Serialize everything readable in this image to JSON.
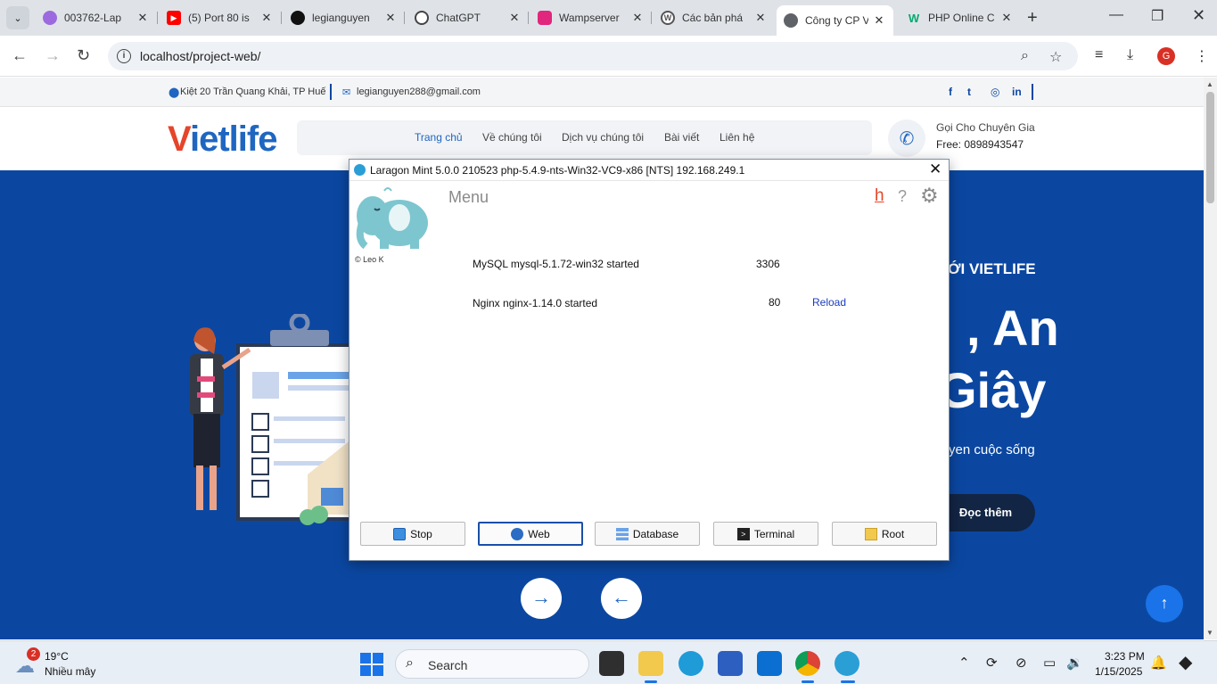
{
  "browser": {
    "tabs": [
      {
        "title": "003762-Lap",
        "favicon_color": "#9c6ade"
      },
      {
        "title": "(5) Port 80 is",
        "favicon_color": "#ff0000"
      },
      {
        "title": "legianguyen",
        "favicon_color": "#111111"
      },
      {
        "title": "ChatGPT",
        "favicon_color": "#444444"
      },
      {
        "title": "Wampserver",
        "favicon_color": "#e0267d"
      },
      {
        "title": "Các bản phá",
        "favicon_color": "#555555"
      },
      {
        "title": "Công ty CP V",
        "favicon_color": "#5f6368"
      },
      {
        "title": "PHP Online C",
        "favicon_color": "#04aa6d"
      }
    ],
    "url": "localhost/project-web/",
    "profile_initial": "G"
  },
  "site": {
    "topbar": {
      "address": "Kiệt 20 Trần Quang Khải, TP Huế",
      "email": "legianguyen288@gmail.com"
    },
    "logo": {
      "v": "V",
      "rest": "ietlife"
    },
    "nav": [
      "Trang chủ",
      "Về chúng tôi",
      "Dịch vụ chúng tôi",
      "Bài viết",
      "Liên hệ"
    ],
    "call": {
      "label": "Gọi Cho Chuyên Gia",
      "number": "Free: 0898943547"
    },
    "hero": {
      "tag": "ỚI VIETLIFE",
      "line1": ", An",
      "line2": "Giây",
      "sub": "yen cuộc sống",
      "button": "Đọc thêm"
    }
  },
  "laragon": {
    "title": "Laragon Mint 5.0.0 210523 php-5.4.9-nts-Win32-VC9-x86 [NTS]  192.168.249.1",
    "menu_label": "Menu",
    "author": "© Leo K",
    "services": [
      {
        "name": "MySQL mysql-5.1.72-win32 started",
        "port": "3306",
        "action": ""
      },
      {
        "name": "Nginx nginx-1.14.0 started",
        "port": "80",
        "action": "Reload"
      }
    ],
    "buttons": [
      "Stop",
      "Web",
      "Database",
      "Terminal",
      "Root"
    ]
  },
  "taskbar": {
    "weather_badge": "2",
    "temperature": "19°C",
    "weather_desc": "Nhiều mây",
    "search_label": "Search",
    "time": "3:23 PM",
    "date": "1/15/2025"
  }
}
